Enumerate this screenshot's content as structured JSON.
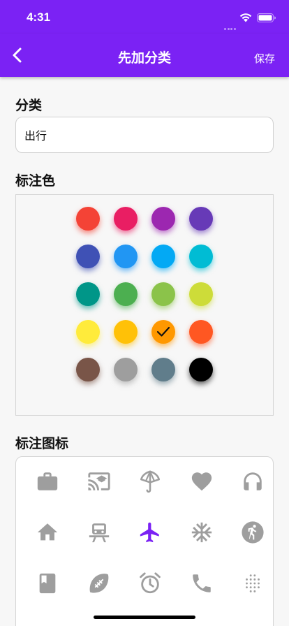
{
  "status_bar": {
    "time": "4:31"
  },
  "nav": {
    "title": "先加分类",
    "save_label": "保存"
  },
  "form": {
    "category_label": "分类",
    "category_value": "出行",
    "color_label": "标注色",
    "icon_label": "标注图标"
  },
  "colors": [
    "#f44336",
    "#e91e63",
    "#9c27b0",
    "#673ab7",
    "#3f51b5",
    "#2196f3",
    "#03a9f4",
    "#00bcd4",
    "#009688",
    "#4caf50",
    "#8bc34a",
    "#cddc39",
    "#ffeb3b",
    "#ffc107",
    "#ff9800",
    "#ff5722",
    "#795548",
    "#9e9e9e",
    "#607d8b",
    "#000000"
  ],
  "selected_color": "#ff9800",
  "icon_color": "#9e9e9e",
  "accent_color": "#7b22f4",
  "icons": [
    "briefcase-icon",
    "cast-for-education-icon",
    "umbrella-icon",
    "heart-icon",
    "headphones-icon",
    "home-icon",
    "train-icon",
    "airplane-icon",
    "snowflake-icon",
    "runner-icon",
    "book-icon",
    "football-icon",
    "alarm-clock-icon",
    "phone-icon",
    "grain-icon"
  ],
  "selected_icon": "airplane-icon"
}
